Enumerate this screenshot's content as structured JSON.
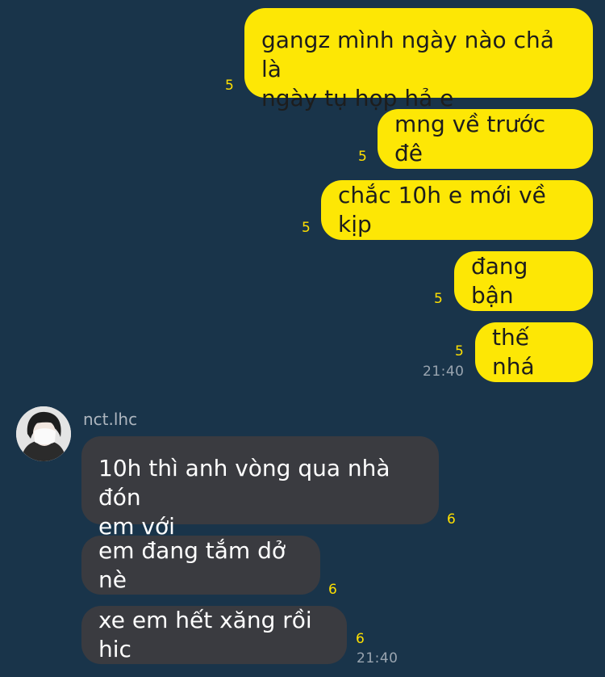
{
  "outgoing": [
    {
      "lines": [
        "gangz mình ngày nào chả là",
        "ngày tụ họp hả e"
      ],
      "unread": "5"
    },
    {
      "lines": [
        "mng về trước đê"
      ],
      "unread": "5"
    },
    {
      "lines": [
        "chắc 10h e mới về kịp"
      ],
      "unread": "5"
    },
    {
      "lines": [
        "đang bận"
      ],
      "unread": "5"
    },
    {
      "lines": [
        "thế nhá"
      ],
      "unread": "5",
      "time": "21:40"
    }
  ],
  "sender": {
    "name": "nct.lhc",
    "avatar": "profile-photo-masked-person"
  },
  "incoming": [
    {
      "lines": [
        "10h thì anh vòng qua nhà đón",
        "em với"
      ],
      "unread": "6"
    },
    {
      "lines": [
        "em đang tắm dở nè"
      ],
      "unread": "6"
    },
    {
      "lines": [
        "xe em hết xăng rồi hic"
      ],
      "unread": "6",
      "time": "21:40"
    }
  ],
  "colors": {
    "background": "#19344a",
    "outgoing_bubble": "#fde705",
    "incoming_bubble": "#3a3b40",
    "unread_count": "#ffe000"
  }
}
